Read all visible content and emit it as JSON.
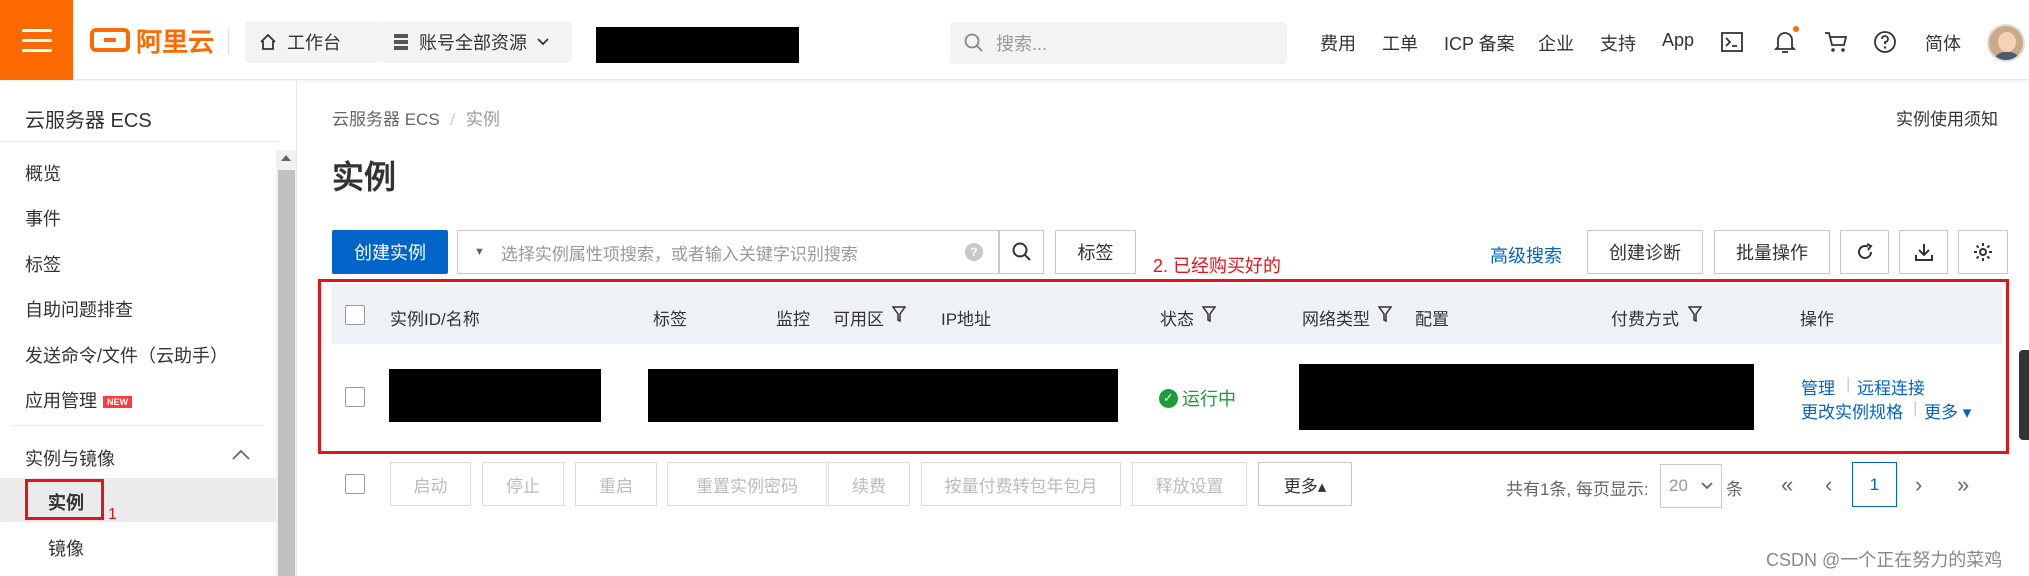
{
  "topbar": {
    "logo_text": "阿里云",
    "workbench_label": "工作台",
    "resources_label": "账号全部资源",
    "search_placeholder": "搜索...",
    "nav": [
      "费用",
      "工单",
      "ICP 备案",
      "企业",
      "支持",
      "App"
    ],
    "lang_label": "简体",
    "brand_color": "#ff6a00"
  },
  "sidebar": {
    "title": "云服务器 ECS",
    "items": [
      "概览",
      "事件",
      "标签",
      "自助问题排查",
      "发送命令/文件（云助手）",
      "应用管理"
    ],
    "new_badge": "NEW",
    "group_label": "实例与镜像",
    "sub_items": [
      "实例",
      "镜像"
    ],
    "annotation": "1"
  },
  "main": {
    "breadcrumb_root": "云服务器 ECS",
    "breadcrumb_sep": "/",
    "breadcrumb_current": "实例",
    "title": "实例",
    "usage_notice": "实例使用须知",
    "create_button": "创建实例",
    "search_placeholder": "选择实例属性项搜索，或者输入关键字识别搜索",
    "tag_button": "标签",
    "annotation": "2. 已经购买好的",
    "advanced_search": "高级搜索",
    "diagnose_button": "创建诊断",
    "batch_button": "批量操作",
    "accent_color": "#0064c8"
  },
  "table": {
    "columns": [
      "实例ID/名称",
      "标签",
      "监控",
      "可用区",
      "IP地址",
      "状态",
      "网络类型",
      "配置",
      "付费方式",
      "操作"
    ],
    "row": {
      "status": "运行中",
      "actions": [
        "管理",
        "远程连接",
        "更改实例规格",
        "更多"
      ]
    }
  },
  "bottom": {
    "buttons": [
      "启动",
      "停止",
      "重启",
      "重置实例密码",
      "续费",
      "按量付费转包年包月",
      "释放设置"
    ],
    "more_button": "更多▴",
    "total_text": "共有1条, 每页显示:",
    "page_size": "20",
    "unit": "条",
    "current_page": "1"
  },
  "watermark": "CSDN @一个正在努力的菜鸡"
}
